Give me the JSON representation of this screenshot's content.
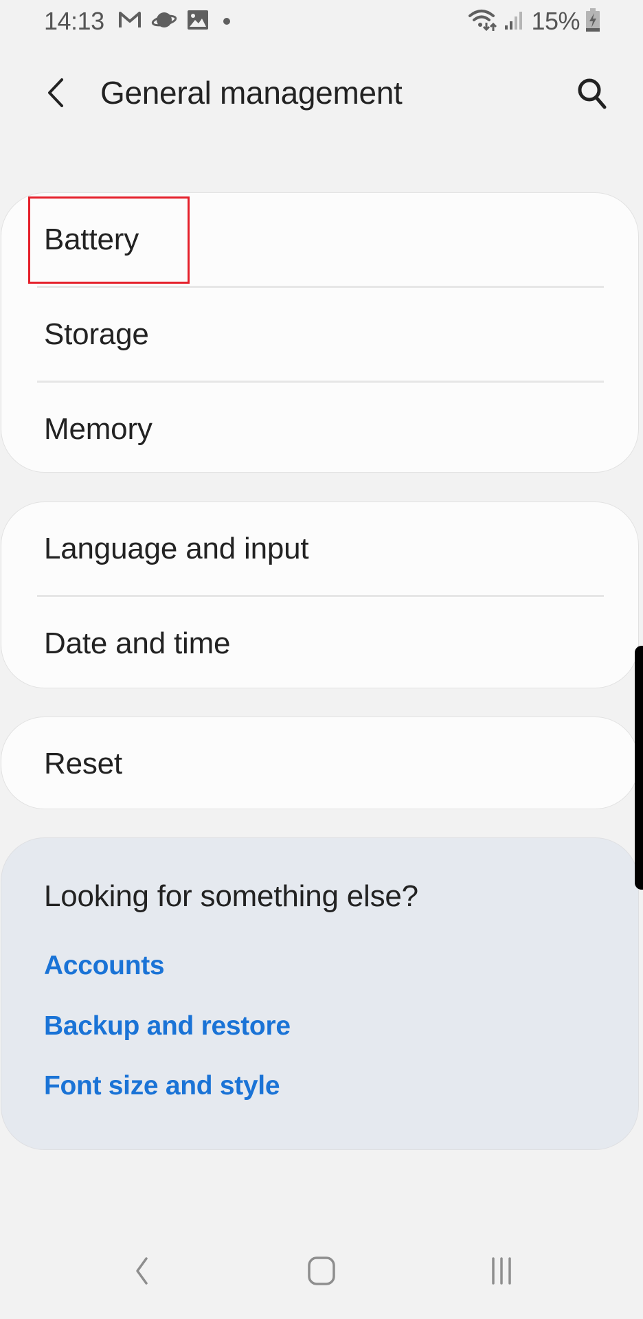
{
  "status_bar": {
    "time": "14:13",
    "notification_icons": [
      "gmail-icon",
      "planet-icon",
      "gallery-icon",
      "dot-icon"
    ],
    "battery_percent": "15%",
    "battery_level": 0.15,
    "battery_charging": true
  },
  "app_bar": {
    "title": "General management",
    "back_label": "Back",
    "search_label": "Search"
  },
  "groups": [
    {
      "items": [
        {
          "label": "Battery",
          "highlighted": true
        },
        {
          "label": "Storage"
        },
        {
          "label": "Memory"
        }
      ]
    },
    {
      "items": [
        {
          "label": "Language and input"
        },
        {
          "label": "Date and time"
        }
      ]
    },
    {
      "items": [
        {
          "label": "Reset"
        }
      ]
    }
  ],
  "suggestions": {
    "title": "Looking for something else?",
    "links": [
      {
        "label": "Accounts"
      },
      {
        "label": "Backup and restore"
      },
      {
        "label": "Font size and style"
      }
    ],
    "link_color": "#1a73d6"
  },
  "highlight_color": "#e5202b",
  "nav_bar": {
    "buttons": [
      "back",
      "home",
      "recents"
    ]
  }
}
